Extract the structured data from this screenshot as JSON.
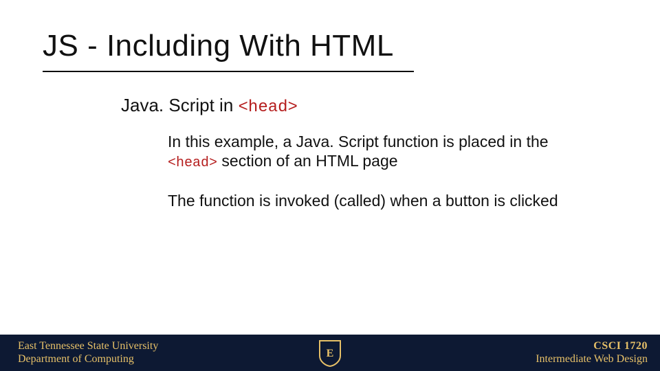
{
  "title": "JS - Including With HTML",
  "subhead": {
    "prefix": "Java. Script in ",
    "code": "<head>"
  },
  "body": {
    "p1_a": "In this example, a Java. Script function is placed in the ",
    "p1_code": "<head>",
    "p1_b": " section of an HTML page",
    "p2": "The function is invoked (called) when a button is clicked"
  },
  "footer": {
    "left1": "East Tennessee State University",
    "left2": "Department of Computing",
    "right1": "CSCI 1720",
    "right2": "Intermediate Web Design",
    "logo_letter": "E"
  },
  "colors": {
    "code_red": "#b51d1d",
    "footer_bg": "#0d1933",
    "footer_gold": "#e6c068"
  }
}
